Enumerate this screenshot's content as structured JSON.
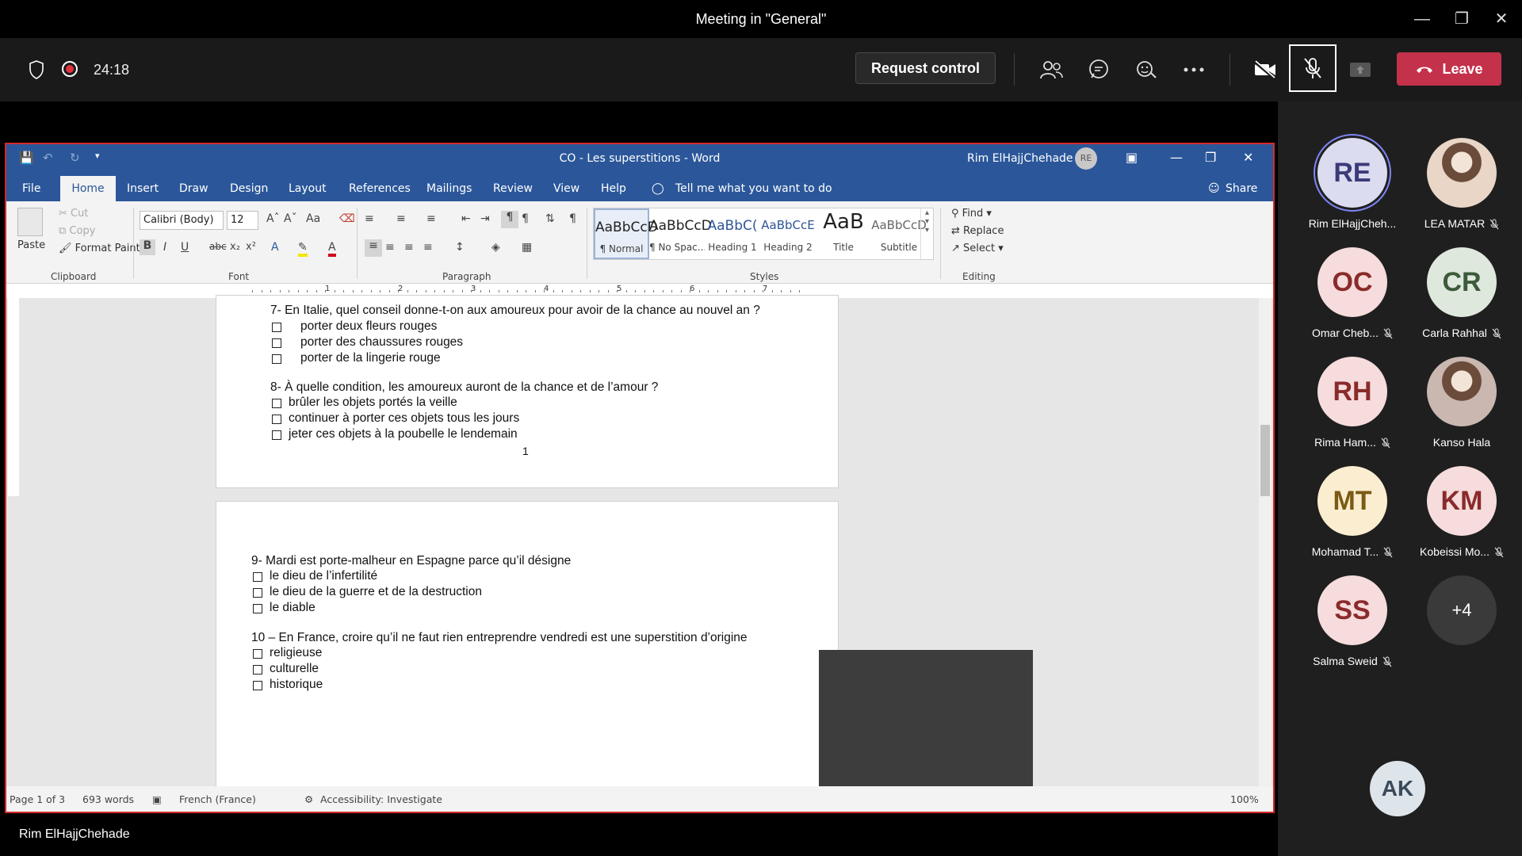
{
  "window": {
    "title": "Meeting in \"General\""
  },
  "meeting": {
    "timer": "24:18",
    "request_control": "Request control",
    "leave": "Leave",
    "presenter_name": "Rim ElHajjChehade"
  },
  "word": {
    "doc_title": "CO - Les superstitions  -  Word",
    "user_name": "Rim ElHajjChehade",
    "user_initials": "RE",
    "menu": [
      "File",
      "Home",
      "Insert",
      "Draw",
      "Design",
      "Layout",
      "References",
      "Mailings",
      "Review",
      "View",
      "Help"
    ],
    "tell_me": "Tell me what you want to do",
    "share": "Share",
    "clipboard": {
      "paste": "Paste",
      "cut": "Cut",
      "copy": "Copy",
      "format_painter": "Format Painter",
      "label": "Clipboard"
    },
    "font": {
      "name": "Calibri (Body)",
      "size": "12",
      "label": "Font"
    },
    "paragraph_label": "Paragraph",
    "styles": {
      "label": "Styles",
      "items": [
        {
          "sample": "AaBbCcD",
          "name": "¶ Normal"
        },
        {
          "sample": "AaBbCcD",
          "name": "¶ No Spac..."
        },
        {
          "sample": "AaBbC(",
          "name": "Heading 1"
        },
        {
          "sample": "AaBbCcE",
          "name": "Heading 2"
        },
        {
          "sample": "AaB",
          "name": "Title"
        },
        {
          "sample": "AaBbCcD",
          "name": "Subtitle"
        }
      ]
    },
    "editing": {
      "find": "Find",
      "replace": "Replace",
      "select": "Select",
      "label": "Editing"
    },
    "ruler_numbers": [
      "1",
      "2",
      "3",
      "4",
      "5",
      "6",
      "7"
    ],
    "page1": {
      "q7": "7- En Italie, quel conseil donne-t-on aux amoureux pour avoir de la chance au nouvel an ?",
      "q7_options": [
        "porter deux fleurs rouges",
        "porter des chaussures rouges",
        "porter de la lingerie rouge"
      ],
      "q8": "8- À quelle condition, les amoureux auront de la chance et de l’amour ?",
      "q8_options": [
        "brûler les objets portés la veille",
        "continuer à porter ces objets tous les jours",
        "jeter ces objets à la poubelle le lendemain"
      ],
      "page_number": "1"
    },
    "page2": {
      "q9": "9- Mardi est porte-malheur en Espagne parce qu’il désigne",
      "q9_options": [
        "le dieu de l’infertilité",
        "le dieu de la guerre et de la destruction",
        "le diable"
      ],
      "q10": "10 – En France, croire qu’il ne faut rien entreprendre vendredi est une superstition d’origine",
      "q10_options": [
        "religieuse",
        "culturelle",
        "historique"
      ]
    },
    "status": {
      "page": "Page 1 of 3",
      "words": "693 words",
      "language": "French (France)",
      "accessibility": "Accessibility: Investigate",
      "zoom": "100%"
    }
  },
  "participants": [
    {
      "initials": "RE",
      "name": "Rim ElHajjCheh...",
      "bg": "#dcdcf0",
      "fg": "#3b3b7a",
      "muted": false,
      "photo": false,
      "ring": true
    },
    {
      "initials": "",
      "name": "LEA MATAR",
      "bg": "#e9d6c6",
      "fg": "#000",
      "muted": true,
      "photo": true
    },
    {
      "initials": "OC",
      "name": "Omar Cheb...",
      "bg": "#f6dcdc",
      "fg": "#8a2b2b",
      "muted": true,
      "photo": false
    },
    {
      "initials": "CR",
      "name": "Carla Rahhal",
      "bg": "#dfe8dd",
      "fg": "#3d5a3a",
      "muted": true,
      "photo": false
    },
    {
      "initials": "RH",
      "name": "Rima Ham...",
      "bg": "#f6dcdc",
      "fg": "#8a2b2b",
      "muted": true,
      "photo": false
    },
    {
      "initials": "",
      "name": "Kanso Hala",
      "bg": "#c9b7b0",
      "fg": "#000",
      "muted": false,
      "photo": true
    },
    {
      "initials": "MT",
      "name": "Mohamad T...",
      "bg": "#fbeed0",
      "fg": "#7a5a14",
      "muted": true,
      "photo": false
    },
    {
      "initials": "KM",
      "name": "Kobeissi Mo...",
      "bg": "#f6dcdc",
      "fg": "#8a2b2b",
      "muted": true,
      "photo": false
    },
    {
      "initials": "SS",
      "name": "Salma Sweid",
      "bg": "#f6dcdc",
      "fg": "#8a2b2b",
      "muted": true,
      "photo": false
    },
    {
      "initials": "+4",
      "name": "",
      "bg": "#3a3a3a",
      "fg": "#ffffff",
      "muted": false,
      "photo": false
    }
  ],
  "self_avatar": "AK",
  "colors": {
    "accent_word": "#2b579a",
    "leave": "#c4314b",
    "share_border": "#d42a2a"
  }
}
